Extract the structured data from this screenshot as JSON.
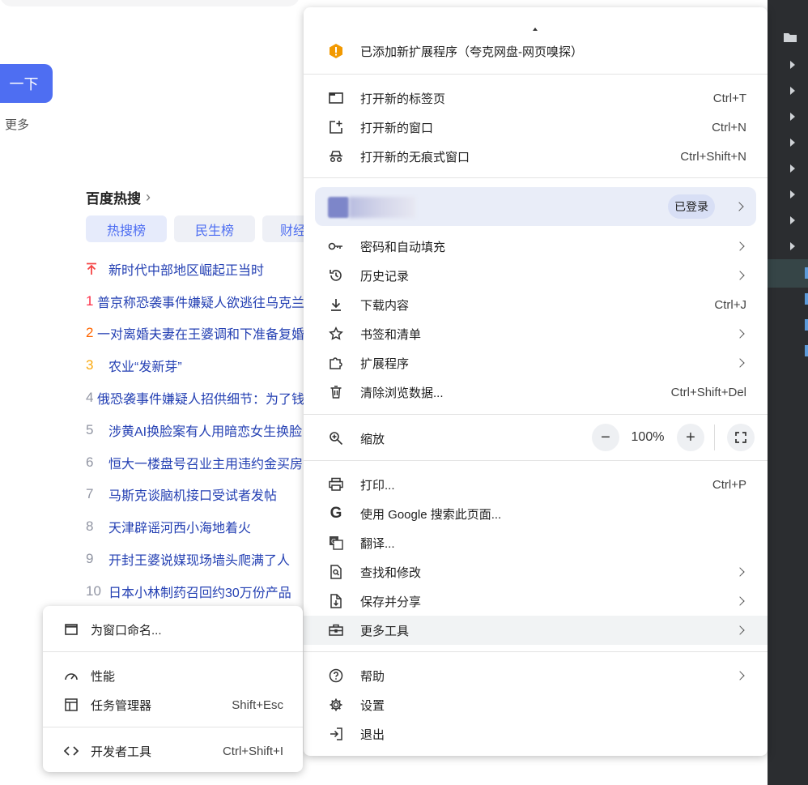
{
  "page": {
    "search_button_label": "一下",
    "more_link": "更多",
    "hot": {
      "title": "百度热搜",
      "tabs": [
        "热搜榜",
        "民生榜",
        "财经"
      ],
      "items": [
        {
          "rank": "",
          "text": "新时代中部地区崛起正当时"
        },
        {
          "rank": "1",
          "text": "普京称恐袭事件嫌疑人欲逃往乌克兰"
        },
        {
          "rank": "2",
          "text": "一对离婚夫妻在王婆调和下准备复婚"
        },
        {
          "rank": "3",
          "text": "农业“发新芽”"
        },
        {
          "rank": "4",
          "text": "俄恐袭事件嫌疑人招供细节：为了钱"
        },
        {
          "rank": "5",
          "text": "涉黄AI换脸案有人用暗恋女生换脸"
        },
        {
          "rank": "6",
          "text": "恒大一楼盘号召业主用违约金买房"
        },
        {
          "rank": "7",
          "text": "马斯克谈脑机接口受试者发帖"
        },
        {
          "rank": "8",
          "text": "天津辟谣河西小海地着火"
        },
        {
          "rank": "9",
          "text": "开封王婆说媒现场墙头爬满了人"
        },
        {
          "rank": "10",
          "text": "日本小林制药召回约30万份产品"
        }
      ],
      "rank_colors": {
        "top": "#f54545",
        "1": "#fe2d46",
        "2": "#f60",
        "3": "#faa90e",
        "rest": "#9195a3"
      }
    }
  },
  "menu": {
    "notice": "已添加新扩展程序（夸克网盘-网页嗅探）",
    "new_tab": {
      "label": "打开新的标签页",
      "shortcut": "Ctrl+T"
    },
    "new_window": {
      "label": "打开新的窗口",
      "shortcut": "Ctrl+N"
    },
    "incognito": {
      "label": "打开新的无痕式窗口",
      "shortcut": "Ctrl+Shift+N"
    },
    "profile": {
      "status": "已登录"
    },
    "passwords": {
      "label": "密码和自动填充"
    },
    "history": {
      "label": "历史记录"
    },
    "downloads": {
      "label": "下载内容",
      "shortcut": "Ctrl+J"
    },
    "bookmarks": {
      "label": "书签和清单"
    },
    "extensions": {
      "label": "扩展程序"
    },
    "clear_data": {
      "label": "清除浏览数据...",
      "shortcut": "Ctrl+Shift+Del"
    },
    "zoom": {
      "label": "缩放",
      "value": "100%",
      "minus": "−",
      "plus": "+"
    },
    "print": {
      "label": "打印...",
      "shortcut": "Ctrl+P"
    },
    "google_search": {
      "label": "使用 Google 搜索此页面..."
    },
    "translate": {
      "label": "翻译..."
    },
    "find": {
      "label": "查找和修改"
    },
    "save_share": {
      "label": "保存并分享"
    },
    "more_tools": {
      "label": "更多工具"
    },
    "help": {
      "label": "帮助"
    },
    "settings": {
      "label": "设置"
    },
    "exit": {
      "label": "退出"
    }
  },
  "submenu": {
    "name_window": {
      "label": "为窗口命名..."
    },
    "performance": {
      "label": "性能"
    },
    "task_manager": {
      "label": "任务管理器",
      "shortcut": "Shift+Esc"
    },
    "devtools": {
      "label": "开发者工具",
      "shortcut": "Ctrl+Shift+I"
    }
  },
  "colors": {
    "accent": "#4e6ef2",
    "link": "#2440b3",
    "warning": "#f29900",
    "sidebar": "#2b2d30"
  }
}
